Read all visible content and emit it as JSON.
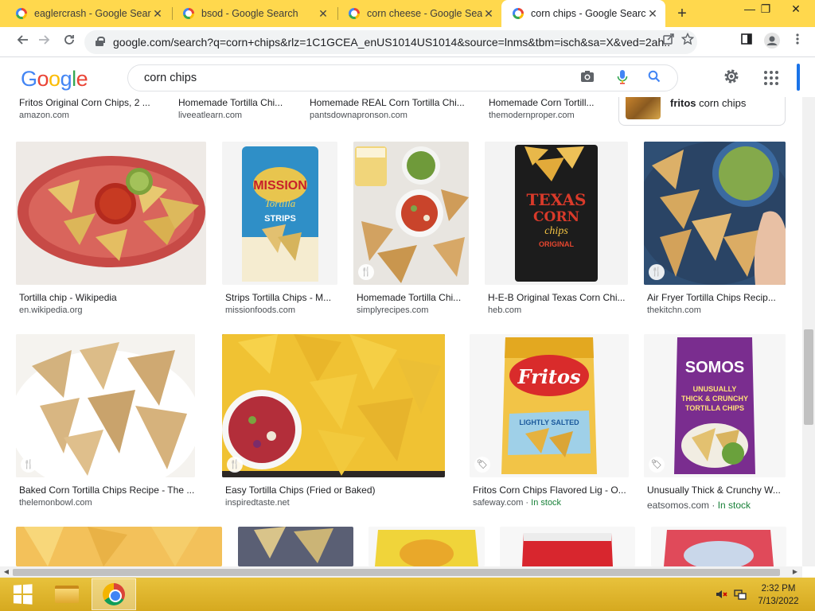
{
  "tabs": [
    {
      "title": "eaglercrash - Google Search",
      "active": false
    },
    {
      "title": "bsod - Google Search",
      "active": false
    },
    {
      "title": "corn cheese - Google Search",
      "active": false
    },
    {
      "title": "corn chips - Google Search",
      "active": true
    }
  ],
  "tab_close": "✕",
  "new_tab_label": "+",
  "window_controls": {
    "minimize": "—",
    "restore": "❐",
    "close": "✕"
  },
  "address_bar": {
    "url": "google.com/search?q=corn+chips&rlz=1C1GCEA_enUS1014US1014&source=lnms&tbm=isch&sa=X&ved=2ah..."
  },
  "google": {
    "logo_letters": [
      "G",
      "o",
      "o",
      "g",
      "l",
      "e"
    ],
    "logo_colors": [
      "#4285f4",
      "#ea4335",
      "#fbbc05",
      "#4285f4",
      "#34a853",
      "#ea4335"
    ],
    "query": "corn chips"
  },
  "top_row": [
    {
      "title": "Fritos Original Corn Chips, 2 ...",
      "source": "amazon.com"
    },
    {
      "title": "Homemade Tortilla Chi...",
      "source": "liveeatlearn.com"
    },
    {
      "title": "Homemade REAL Corn Tortilla Chi...",
      "source": "pantsdownapronson.com"
    },
    {
      "title": "Homemade Corn Tortill...",
      "source": "themodernproper.com"
    }
  ],
  "related_chip": {
    "bold": "fritos",
    "rest": " corn chips"
  },
  "row1": [
    {
      "title": "Tortilla chip - Wikipedia",
      "source": "en.wikipedia.org",
      "badge": ""
    },
    {
      "title": "Strips Tortilla Chips - M...",
      "source": "missionfoods.com",
      "badge": ""
    },
    {
      "title": "Homemade Tortilla Chi...",
      "source": "simplyrecipes.com",
      "badge": "🍴"
    },
    {
      "title": "H-E-B Original Texas Corn Chi...",
      "source": "heb.com",
      "badge": ""
    },
    {
      "title": "Air Fryer Tortilla Chips Recip...",
      "source": "thekitchn.com",
      "badge": "🍴"
    }
  ],
  "row2": [
    {
      "title": "Baked Corn Tortilla Chips Recipe - The ...",
      "source": "thelemonbowl.com",
      "stock": "",
      "badge": "🍴"
    },
    {
      "title": "Easy Tortilla Chips (Fried or Baked)",
      "source": "inspiredtaste.net",
      "stock": "",
      "badge": "🍴"
    },
    {
      "title": "Fritos Corn Chips Flavored Lig - O...",
      "source": "safeway.com · ",
      "stock": "In stock",
      "badge": "🏷"
    },
    {
      "title": "Unusually Thick & Crunchy W...",
      "source": "eatsomos.com · ",
      "stock": "In stock",
      "badge": "🏷"
    }
  ],
  "product_text": {
    "mission_brand": "MISSION",
    "mission_line1": "Tortilla",
    "mission_line2": "STRIPS",
    "texas_line1": "TEXAS",
    "texas_line2": "CORN",
    "texas_line3": "chips",
    "texas_line4": "ORIGINAL",
    "fritos_brand": "Fritos",
    "fritos_sub": "LIGHTLY SALTED",
    "somos_brand": "SOMOS",
    "somos_line1": "UNUSUALLY",
    "somos_line2": "THICK & CRUNCHY",
    "somos_line3": "TORTILLA CHIPS"
  },
  "taskbar": {
    "time": "2:32 PM",
    "date": "7/13/2022"
  },
  "colors": {
    "browser_frame": "#ffd84d",
    "taskbar": "#e0b62c",
    "accent_blue": "#1a73e8"
  }
}
